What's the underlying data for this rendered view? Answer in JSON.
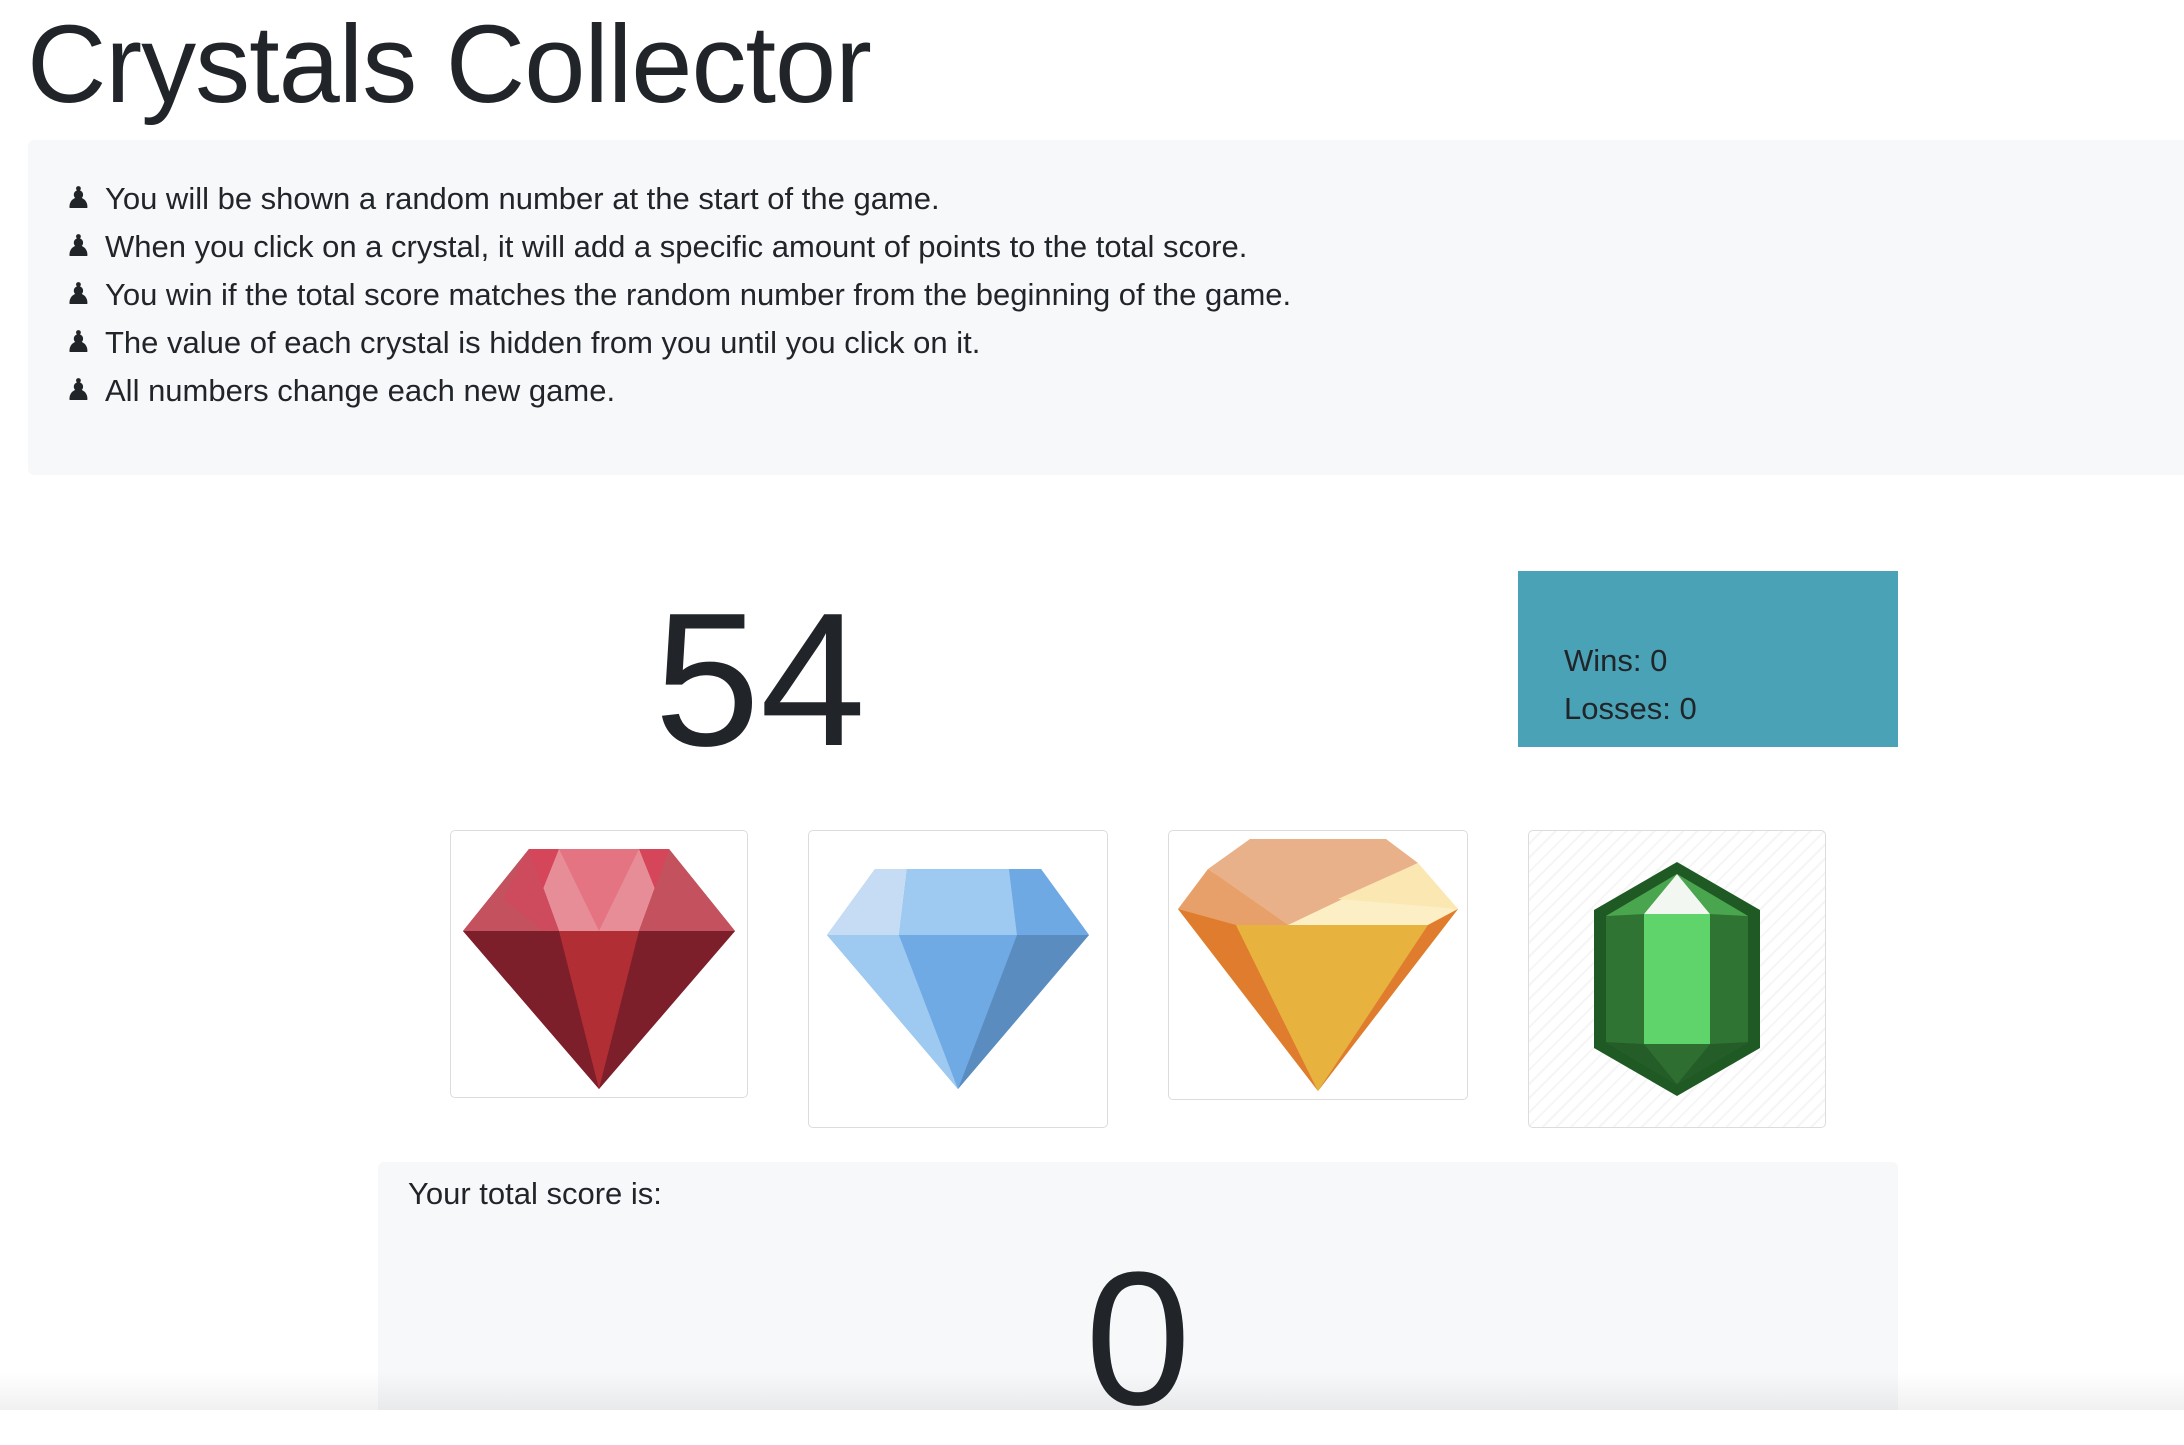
{
  "page": {
    "title": "Crystals Collector"
  },
  "instructions": {
    "bullet_icon": "chess-pawn-icon",
    "items": [
      "You will be shown a random number at the start of the game.",
      "When you click on a crystal, it will add a specific amount of points to the total score.",
      "You win if the total score matches the random number from the beginning of the game.",
      "The value of each crystal is hidden from you until you click on it.",
      "All numbers change each new game."
    ]
  },
  "game": {
    "target_number": "54",
    "stats": {
      "wins_text": "Wins: 0",
      "losses_text": "Losses: 0",
      "panel_color": "#4aa2b6"
    },
    "crystals": [
      {
        "name": "red-ruby",
        "icon": "ruby-gem-icon",
        "color": "#b0303a"
      },
      {
        "name": "blue-diamond",
        "icon": "diamond-gem-icon",
        "color": "#74aee6"
      },
      {
        "name": "yellow-topaz",
        "icon": "topaz-gem-icon",
        "color": "#e8b23e"
      },
      {
        "name": "green-emerald",
        "icon": "emerald-gem-icon",
        "color": "#5bd06a"
      }
    ],
    "score": {
      "label": "Your total score is:",
      "value": "0"
    }
  }
}
